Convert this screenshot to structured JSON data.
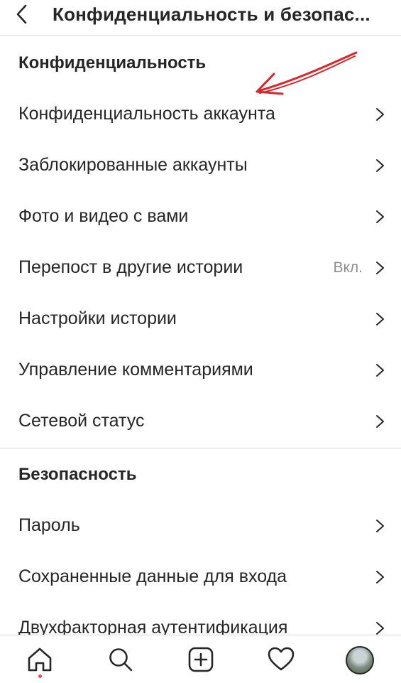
{
  "header": {
    "title": "Конфиденциальность и безопас..."
  },
  "sections": [
    {
      "title": "Конфиденциальность"
    },
    {
      "title": "Безопасность"
    }
  ],
  "rows": [
    {
      "label": "Конфиденциальность аккаунта"
    },
    {
      "label": "Заблокированные аккаунты"
    },
    {
      "label": "Фото и видео с вами"
    },
    {
      "label": "Перепост в другие истории",
      "value": "Вкл."
    },
    {
      "label": "Настройки истории"
    },
    {
      "label": "Управление комментариями"
    },
    {
      "label": "Сетевой статус"
    },
    {
      "label": "Пароль"
    },
    {
      "label": "Сохраненные данные для входа"
    },
    {
      "label": "Двухфакторная аутентификация"
    }
  ],
  "tabs": [
    {
      "icon": "home-icon"
    },
    {
      "icon": "search-icon"
    },
    {
      "icon": "new-post-icon"
    },
    {
      "icon": "activity-heart-icon"
    },
    {
      "icon": "profile-avatar"
    }
  ],
  "colors": {
    "text": "#262626",
    "secondary_text": "#8e8e8e",
    "divider": "#dbdbdb",
    "notification_dot": "#ed4956",
    "annotation_arrow": "#d8262c"
  }
}
